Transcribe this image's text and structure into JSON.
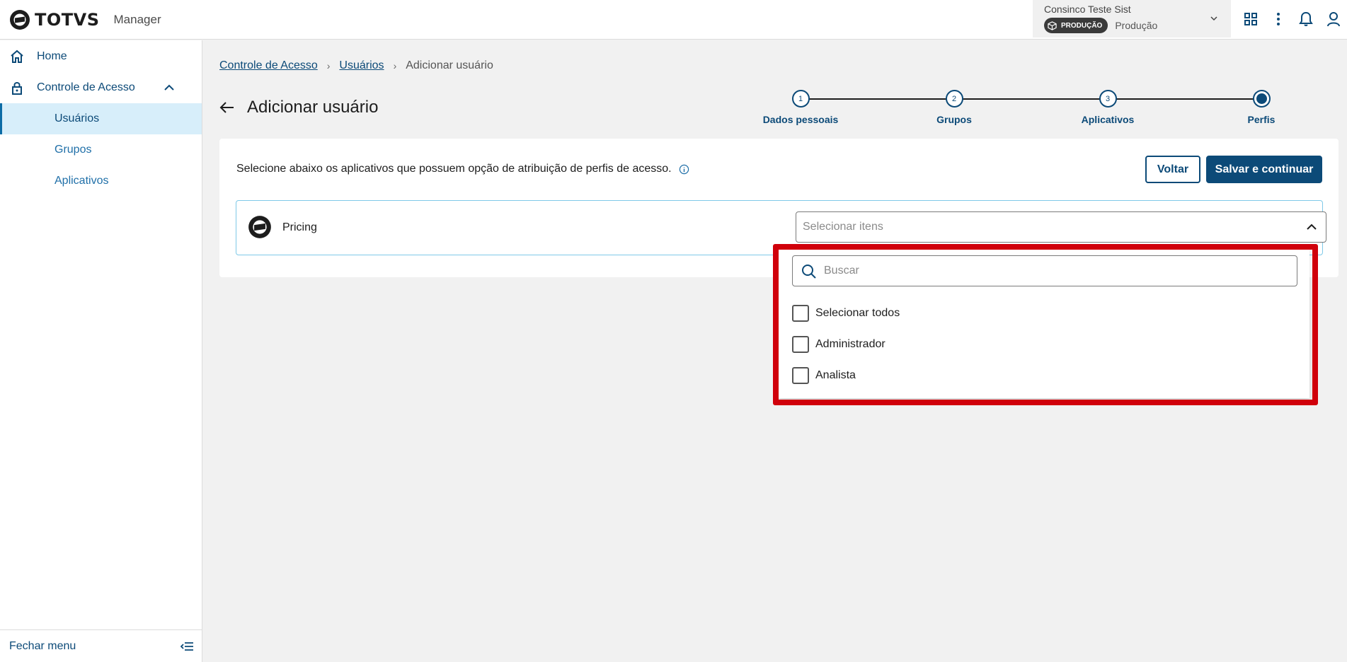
{
  "header": {
    "logo_text": "TOTVS",
    "app_name": "Manager",
    "tenant_name": "Consinco Teste Sist",
    "env_badge": "PRODUÇÃO",
    "env_label": "Produção"
  },
  "sidebar": {
    "items": [
      {
        "label": "Home",
        "icon": "home-icon"
      },
      {
        "label": "Controle de Acesso",
        "icon": "lock-icon",
        "expanded": true
      }
    ],
    "subitems": [
      {
        "label": "Usuários",
        "active": true
      },
      {
        "label": "Grupos"
      },
      {
        "label": "Aplicativos"
      }
    ],
    "footer_label": "Fechar menu"
  },
  "breadcrumb": {
    "items": [
      "Controle de Acesso",
      "Usuários",
      "Adicionar usuário"
    ]
  },
  "page": {
    "title": "Adicionar usuário"
  },
  "stepper": {
    "steps": [
      {
        "number": "1",
        "label": "Dados pessoais"
      },
      {
        "number": "2",
        "label": "Grupos"
      },
      {
        "number": "3",
        "label": "Aplicativos"
      },
      {
        "number": "",
        "label": "Perfis",
        "current": true
      }
    ]
  },
  "card": {
    "description": "Selecione abaixo os aplicativos que possuem opção de atribuição de perfis de acesso.",
    "back_label": "Voltar",
    "save_label": "Salvar e continuar",
    "app_name": "Pricing",
    "select_placeholder": "Selecionar itens"
  },
  "dropdown": {
    "search_placeholder": "Buscar",
    "options": [
      "Selecionar todos",
      "Administrador",
      "Analista"
    ]
  },
  "colors": {
    "primary": "#0c4a78",
    "active_bg": "#d7eefa",
    "highlight": "#d0000b"
  }
}
